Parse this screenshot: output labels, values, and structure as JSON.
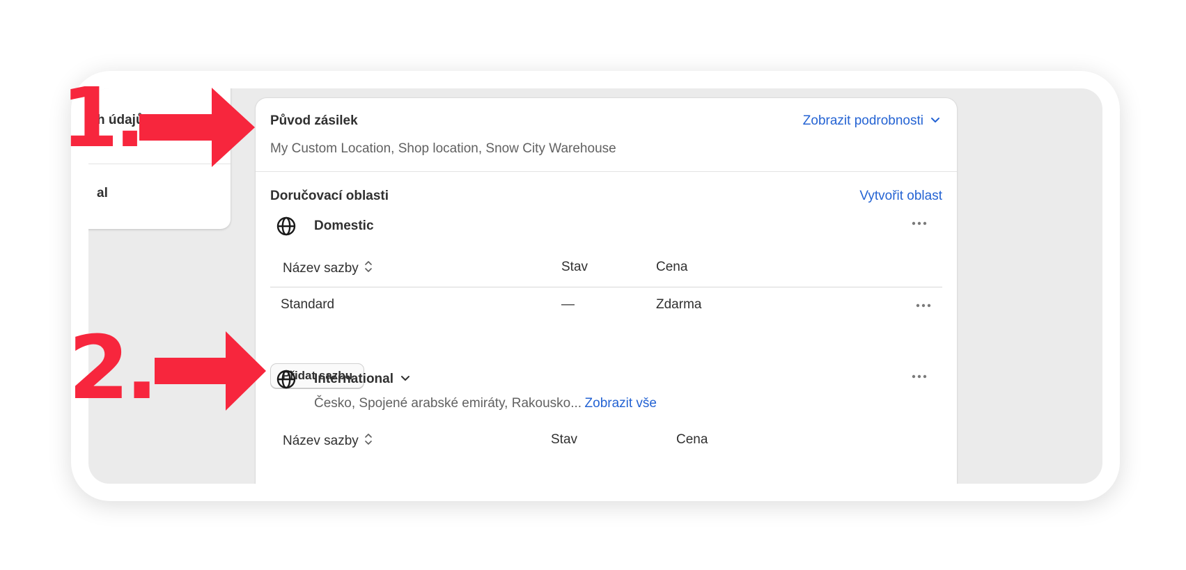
{
  "sidebar": {
    "item1_label": "h údajů",
    "item2_label": "al"
  },
  "origin": {
    "title": "Původ zásilek",
    "details_link": "Zobrazit podrobnosti",
    "locations": "My Custom Location, Shop location, Snow City Warehouse"
  },
  "delivery": {
    "title": "Doručovací oblasti",
    "create_link": "Vytvořit oblast",
    "zones": [
      {
        "name": "Domestic",
        "columns": [
          "Název sazby",
          "Stav",
          "Cena"
        ],
        "rates": [
          {
            "name": "Standard",
            "status": "—",
            "price": "Zdarma"
          }
        ],
        "add_rate_label": "Přidat sazbu"
      },
      {
        "name": "International",
        "countries": "Česko, Spojené arabské emiráty, Rakousko...",
        "show_all_link": "Zobrazit vše",
        "columns": [
          "Název sazby",
          "Stav",
          "Cena"
        ]
      }
    ]
  },
  "annotations": {
    "step1": "1.",
    "step2": "2."
  },
  "colors": {
    "annotation": "#f7263d",
    "link": "#2463d3",
    "background": "#ebebeb"
  },
  "icons": {
    "zone": "globe-icon",
    "menu": "more-horizontal-icon",
    "sort": "sort-icon",
    "chevron": "chevron-down-icon"
  }
}
